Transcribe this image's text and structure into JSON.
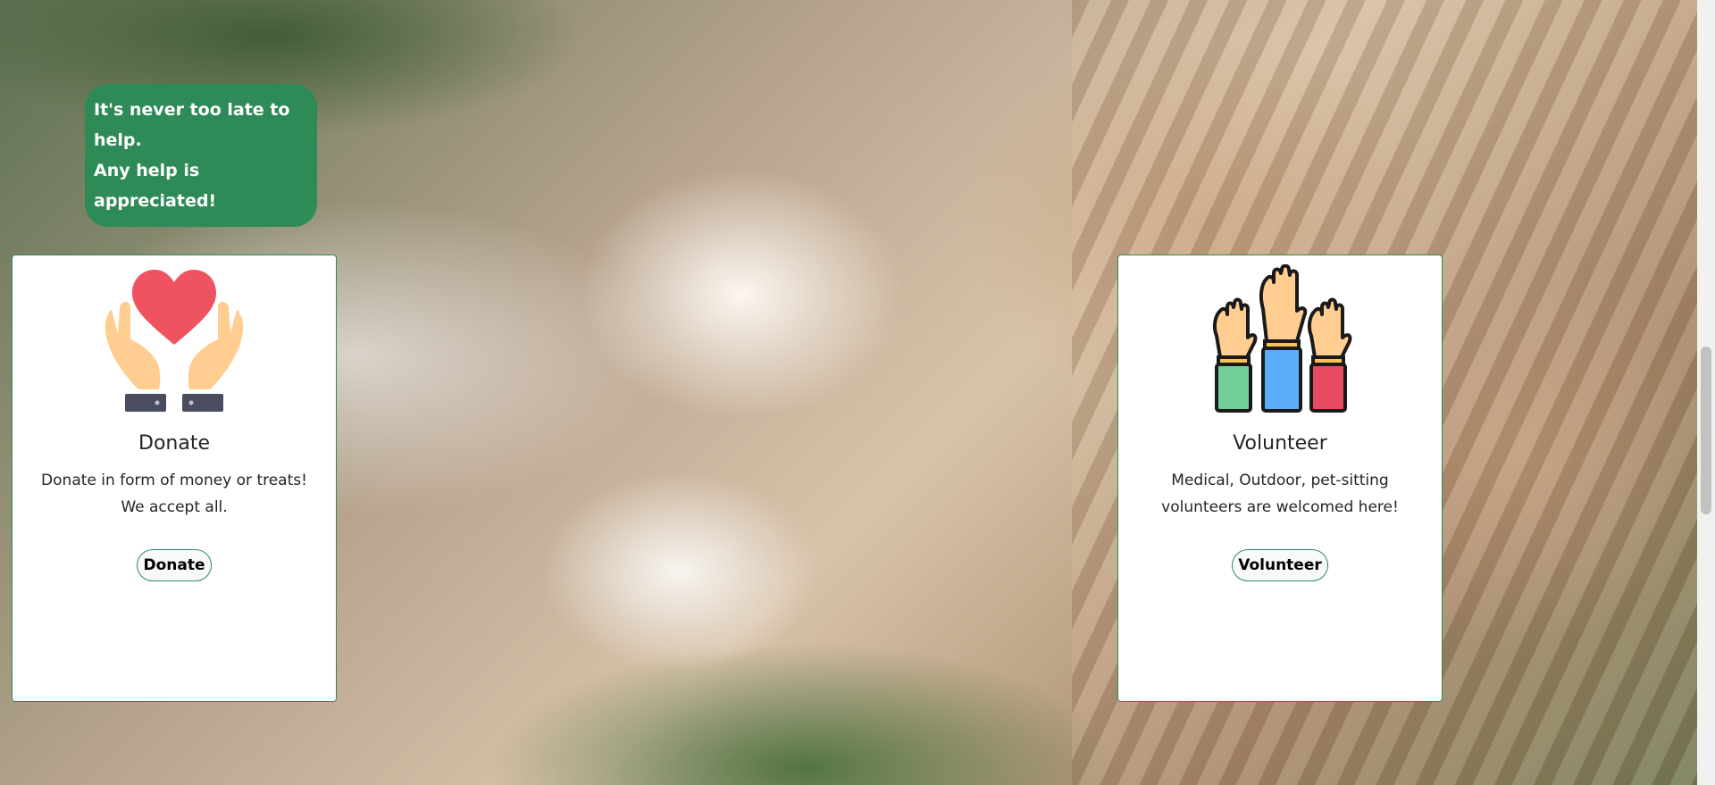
{
  "banner": {
    "line1": "It's never too late to help.",
    "line2": "Any help is appreciated!"
  },
  "cards": {
    "donate": {
      "icon": "heart-hands-icon",
      "title": "Donate",
      "text_line1": "Donate in form of money or treats!",
      "text_line2": "We accept all.",
      "button_label": "Donate"
    },
    "volunteer": {
      "icon": "raised-hands-icon",
      "title": "Volunteer",
      "text_line1": "Medical, Outdoor, pet-sitting",
      "text_line2": "volunteers are welcomed here!",
      "button_label": "Volunteer"
    }
  },
  "colors": {
    "accent": "#2e8b57",
    "heart": "#ef5261",
    "skin": "#ffcd8f"
  }
}
